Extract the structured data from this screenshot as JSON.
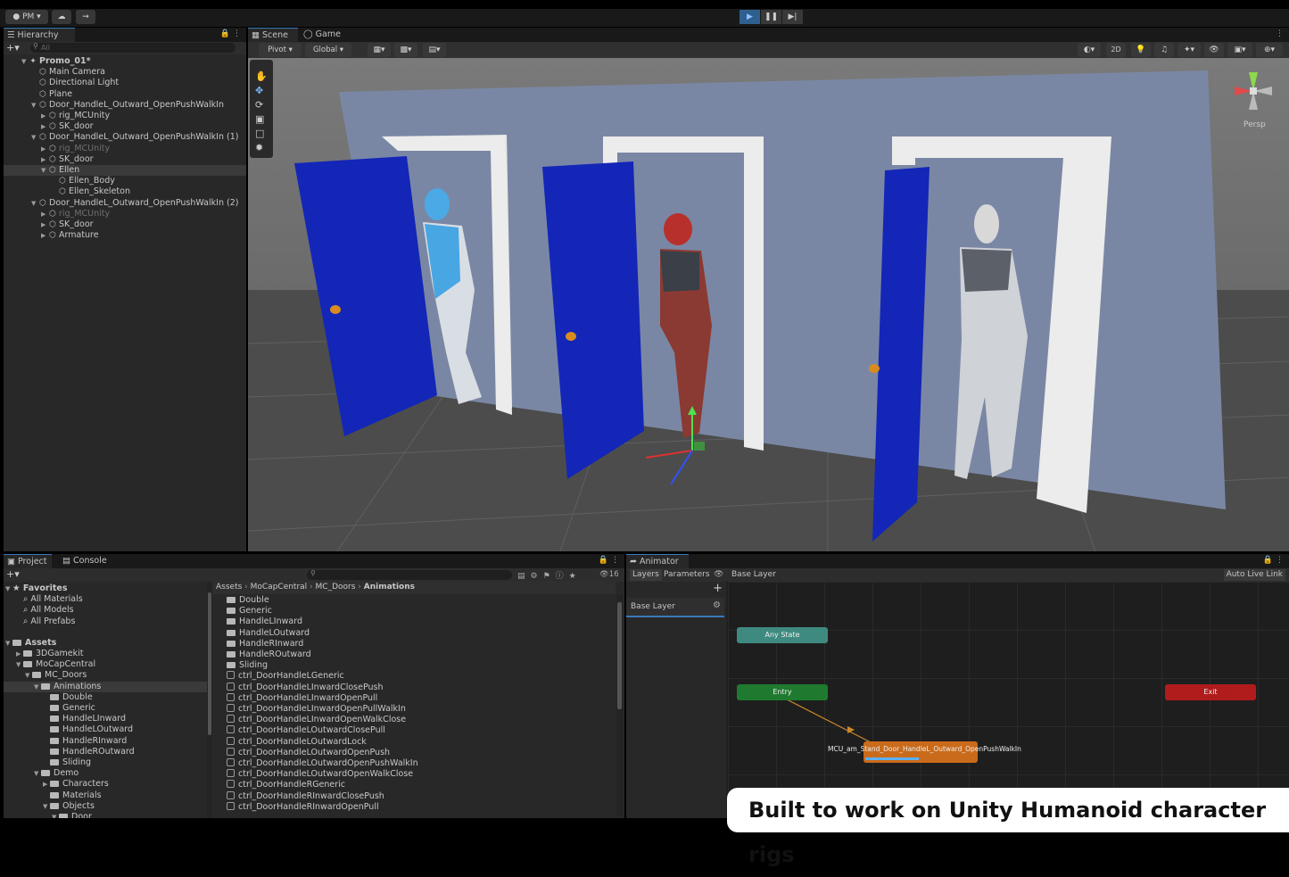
{
  "toolbar": {
    "account": "PM",
    "cloud_icon": "cloud-icon",
    "collab_icon": "collab-icon",
    "play_icon": "play-icon",
    "pause_icon": "pause-icon",
    "step_icon": "step-icon"
  },
  "hierarchy": {
    "tab": "Hierarchy",
    "search_placeholder": "All",
    "items": [
      {
        "label": "Promo_01*",
        "indent": 0
      },
      {
        "label": "Main Camera",
        "indent": 1
      },
      {
        "label": "Directional Light",
        "indent": 1
      },
      {
        "label": "Plane",
        "indent": 1
      },
      {
        "label": "Door_HandleL_Outward_OpenPushWalkIn",
        "indent": 1
      },
      {
        "label": "rig_MCUnity",
        "indent": 2
      },
      {
        "label": "SK_door",
        "indent": 2
      },
      {
        "label": "Door_HandleL_Outward_OpenPushWalkIn (1)",
        "indent": 1
      },
      {
        "label": "rig_MCUnity",
        "indent": 2
      },
      {
        "label": "SK_door",
        "indent": 2
      },
      {
        "label": "Ellen",
        "indent": 2
      },
      {
        "label": "Ellen_Body",
        "indent": 3
      },
      {
        "label": "Ellen_Skeleton",
        "indent": 3
      },
      {
        "label": "Door_HandleL_Outward_OpenPushWalkIn (2)",
        "indent": 1
      },
      {
        "label": "rig_MCUnity",
        "indent": 2
      },
      {
        "label": "SK_door",
        "indent": 2
      },
      {
        "label": "Armature",
        "indent": 2
      }
    ]
  },
  "scene": {
    "tabs": [
      "Scene",
      "Game"
    ],
    "pivot": "Pivot",
    "global": "Global",
    "mode_2d": "2D",
    "persp": "Persp"
  },
  "project": {
    "tabs": [
      "Project",
      "Console"
    ],
    "count": "16",
    "favorites_label": "Favorites",
    "favorites": [
      "All Materials",
      "All Models",
      "All Prefabs"
    ],
    "assets_label": "Assets",
    "tree": [
      "3DGamekit",
      "MoCapCentral",
      "MC_Doors",
      "Animations",
      "Double",
      "Generic",
      "HandleLInward",
      "HandleLOutward",
      "HandleRInward",
      "HandleROutward",
      "Sliding",
      "Demo",
      "Characters",
      "Materials",
      "Objects",
      "Door"
    ],
    "breadcrumb": [
      "Assets",
      "MoCapCentral",
      "MC_Doors",
      "Animations"
    ],
    "folders": [
      "Double",
      "Generic",
      "HandleLInward",
      "HandleLOutward",
      "HandleRInward",
      "HandleROutward",
      "Sliding"
    ],
    "files": [
      "ctrl_DoorHandleLGeneric",
      "ctrl_DoorHandleLInwardClosePush",
      "ctrl_DoorHandleLInwardOpenPull",
      "ctrl_DoorHandleLInwardOpenPullWalkIn",
      "ctrl_DoorHandleLInwardOpenWalkClose",
      "ctrl_DoorHandleLOutwardClosePull",
      "ctrl_DoorHandleLOutwardLock",
      "ctrl_DoorHandleLOutwardOpenPush",
      "ctrl_DoorHandleLOutwardOpenPushWalkIn",
      "ctrl_DoorHandleLOutwardOpenWalkClose",
      "ctrl_DoorHandleRGeneric",
      "ctrl_DoorHandleRInwardClosePush",
      "ctrl_DoorHandleRInwardOpenPull"
    ]
  },
  "animator": {
    "tab": "Animator",
    "layers_tab": "Layers",
    "parameters_tab": "Parameters",
    "breadcrumb": "Base Layer",
    "auto_live": "Auto Live Link",
    "layer_name": "Base Layer",
    "nodes": {
      "any_state": "Any State",
      "entry": "Entry",
      "exit": "Exit",
      "state": "MCU_am_Stand_Door_HandleL_Outward_OpenPushWalkIn"
    }
  },
  "caption": "Built to work on Unity Humanoid character rigs",
  "colors": {
    "accent": "#3a79bb",
    "entry": "#1f7a2f",
    "exit": "#b01c1c",
    "state": "#c96b1a",
    "any": "#3f8a80"
  }
}
